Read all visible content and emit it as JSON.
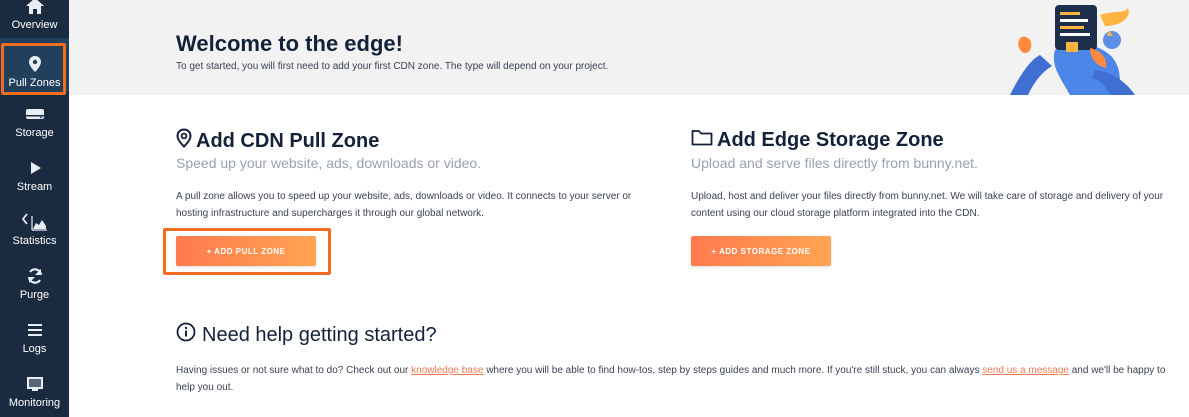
{
  "sidebar": {
    "items": [
      {
        "label": "Overview",
        "icon": "home-icon"
      },
      {
        "label": "Pull Zones",
        "icon": "map-pin-icon",
        "active": true
      },
      {
        "label": "Storage",
        "icon": "storage-icon"
      },
      {
        "label": "Stream",
        "icon": "play-icon"
      },
      {
        "label": "Statistics",
        "icon": "chart-area-icon"
      },
      {
        "label": "Purge",
        "icon": "refresh-icon"
      },
      {
        "label": "Logs",
        "icon": "list-icon"
      },
      {
        "label": "Monitoring",
        "icon": "monitor-icon"
      }
    ]
  },
  "header": {
    "title": "Welcome to the edge!",
    "subtitle": "To get started, you will first need to add your first CDN zone. The type will depend on your project."
  },
  "pull_zone": {
    "title": "Add CDN Pull Zone",
    "subtitle": "Speed up your website, ads, downloads or video.",
    "description": "A pull zone allows you to speed up your website, ads, downloads or video. It connects to your server or hosting infrastructure and supercharges it through our global network.",
    "button_label": "+ ADD PULL ZONE"
  },
  "storage_zone": {
    "title": "Add Edge Storage Zone",
    "subtitle": "Upload and serve files directly from bunny.net.",
    "description": "Upload, host and deliver your files directly from bunny.net. We will take care of storage and delivery of your content using our cloud storage platform integrated into the CDN.",
    "button_label": "+ ADD STORAGE ZONE"
  },
  "help": {
    "title": "Need help getting started?",
    "text_1": "Having issues or not sure what to do? Check out our ",
    "link_1": "knowledge base",
    "text_2": " where you will be able to find how-tos, step by steps guides and much more. If you're still stuck, you can always ",
    "link_2": "send us a message",
    "text_3": " and we'll be happy to help you out."
  },
  "colors": {
    "sidebar_bg": "#1b2b3f",
    "accent_orange": "#ff7a4f",
    "highlight": "#f26d21"
  }
}
